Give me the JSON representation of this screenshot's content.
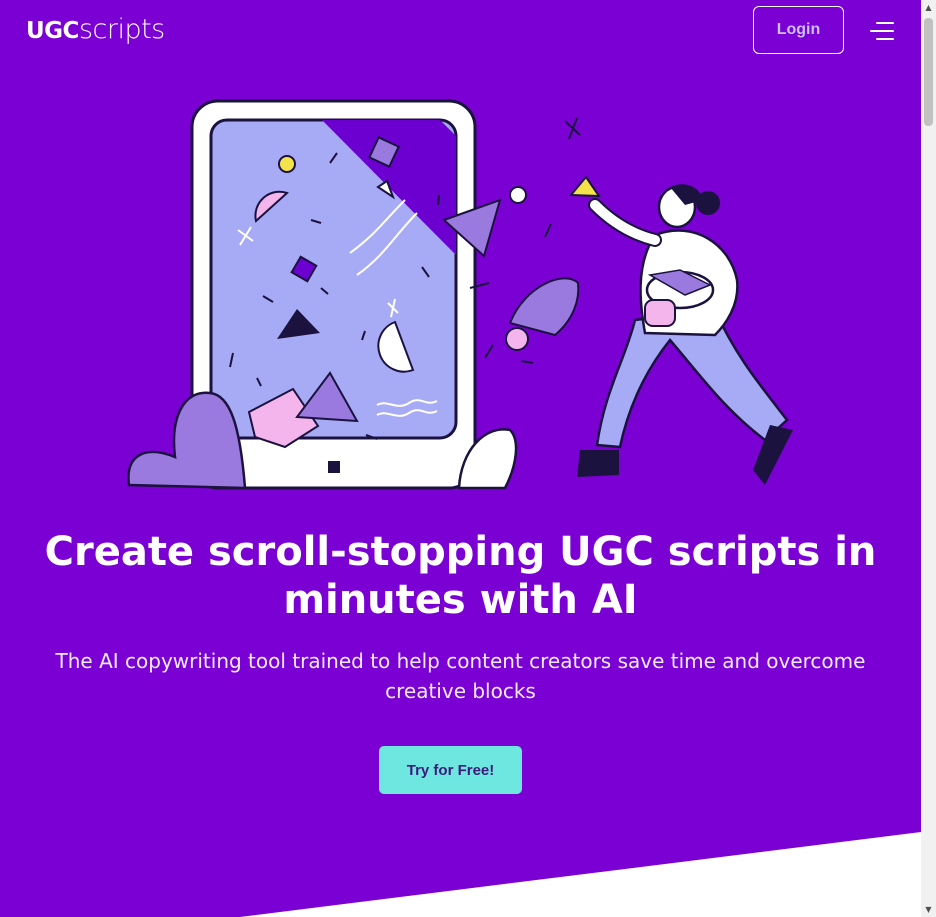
{
  "header": {
    "logo_bold": "UGC",
    "logo_light": "scripts",
    "login_label": "Login",
    "menu_icon": "hamburger-menu-icon"
  },
  "hero": {
    "illustration": "tablet-and-person-with-shapes-illustration",
    "headline": "Create scroll-stopping UGC scripts in minutes with AI",
    "subheadline": "The AI copywriting tool trained to help content creators save time and overcome creative blocks",
    "cta_label": "Try for Free!"
  },
  "colors": {
    "background": "#7a00d4",
    "cta": "#6ee7e0",
    "accent_lavender": "#a7aaf5",
    "accent_pink": "#f3b5ec",
    "accent_purple": "#9b7ae0",
    "white": "#ffffff"
  }
}
